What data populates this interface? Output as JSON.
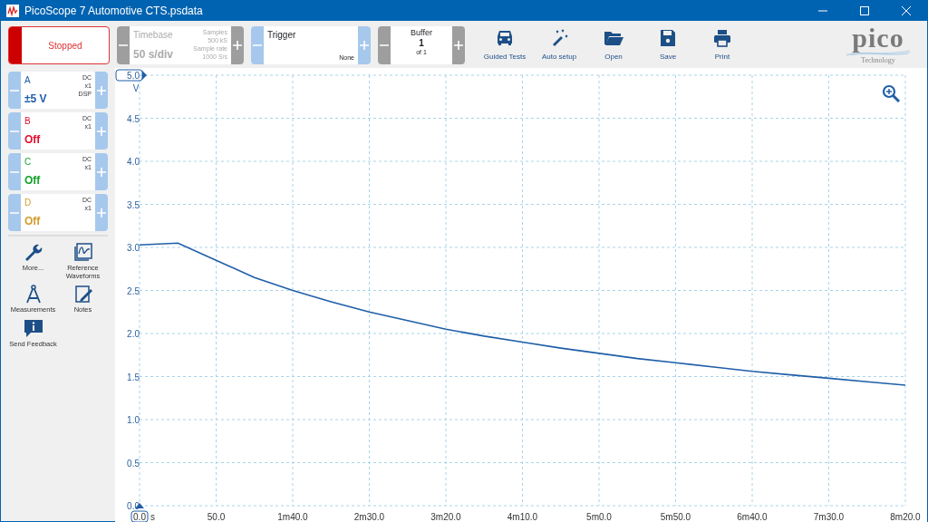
{
  "window": {
    "title": "PicoScope 7 Automotive CTS.psdata"
  },
  "toolbar": {
    "run_state": {
      "label": "Stopped",
      "running": false
    },
    "timebase": {
      "label": "Timebase",
      "value": "50 s/div",
      "samples_label": "Samples",
      "samples": "500 kS",
      "rate_label": "Sample rate",
      "rate": "1000 S/s",
      "disabled": true,
      "greyed": true
    },
    "trigger": {
      "label": "Trigger",
      "mode": "None",
      "disabled": false
    },
    "buffer": {
      "label": "Buffer",
      "value": "1",
      "of": "of 1",
      "disabled": true
    },
    "actions": [
      {
        "label": "Guided Tests",
        "kind": "car"
      },
      {
        "label": "Auto setup",
        "kind": "wand"
      },
      {
        "label": "Open",
        "kind": "folder"
      },
      {
        "label": "Save",
        "kind": "save"
      },
      {
        "label": "Print",
        "kind": "print"
      }
    ],
    "logo": {
      "name": "pico",
      "tagline": "Technology"
    }
  },
  "channels": [
    {
      "name": "A",
      "range": "±5 V",
      "coupling": "DC",
      "probe": "x1",
      "dsp": "DSP",
      "color": "#1f5ea8"
    },
    {
      "name": "B",
      "range": "Off",
      "coupling": "DC",
      "probe": "x1",
      "color": "#e0102f"
    },
    {
      "name": "C",
      "range": "Off",
      "coupling": "DC",
      "probe": "x1",
      "color": "#13a32b"
    },
    {
      "name": "D",
      "range": "Off",
      "coupling": "DC",
      "probe": "x1",
      "color": "#d39c2a"
    }
  ],
  "tools": [
    {
      "label": "More...",
      "kind": "wrench"
    },
    {
      "label": "Reference Waveforms",
      "kind": "reference"
    },
    {
      "label": "Measurements",
      "kind": "compass"
    },
    {
      "label": "Notes",
      "kind": "notes"
    },
    {
      "label": "Send Feedback",
      "kind": "feedback"
    }
  ],
  "chart": {
    "chart_data": {
      "type": "line",
      "xlabel": "s",
      "ylabel": "V",
      "xlim": [
        0,
        500
      ],
      "ylim": [
        0,
        5
      ],
      "x": [
        0,
        25,
        50,
        75,
        100,
        125,
        150,
        175,
        200,
        225,
        250,
        275,
        300,
        325,
        350,
        375,
        400,
        425,
        450,
        475,
        500
      ],
      "grid": true,
      "series": [
        {
          "color": "#1f5ea8",
          "values": [
            3.03,
            3.05,
            2.85,
            2.65,
            2.5,
            2.37,
            2.25,
            2.15,
            2.05,
            1.97,
            1.9,
            1.83,
            1.77,
            1.71,
            1.66,
            1.61,
            1.56,
            1.52,
            1.48,
            1.44,
            1.4
          ]
        }
      ],
      "xticks": [
        {
          "value": 0,
          "label": "0.0"
        },
        {
          "value": 50,
          "label": "50.0"
        },
        {
          "value": 100,
          "label": "1m40.0"
        },
        {
          "value": 150,
          "label": "2m30.0"
        },
        {
          "value": 200,
          "label": "3m20.0"
        },
        {
          "value": 250,
          "label": "4m10.0"
        },
        {
          "value": 300,
          "label": "5m0.0"
        },
        {
          "value": 350,
          "label": "5m50.0"
        },
        {
          "value": 400,
          "label": "6m40.0"
        },
        {
          "value": 450,
          "label": "7m30.0"
        },
        {
          "value": 500,
          "label": "8m20.0"
        }
      ],
      "yticks": [
        {
          "value": 0,
          "label": "0.0"
        },
        {
          "value": 0.5,
          "label": "0.5"
        },
        {
          "value": 1,
          "label": "1.0"
        },
        {
          "value": 1.5,
          "label": "1.5"
        },
        {
          "value": 2,
          "label": "2.0"
        },
        {
          "value": 2.5,
          "label": "2.5"
        },
        {
          "value": 3,
          "label": "3.0"
        },
        {
          "value": 3.5,
          "label": "3.5"
        },
        {
          "value": 4,
          "label": "4.0"
        },
        {
          "value": 4.5,
          "label": "4.5"
        },
        {
          "value": 5,
          "label": "5.0"
        }
      ]
    }
  }
}
